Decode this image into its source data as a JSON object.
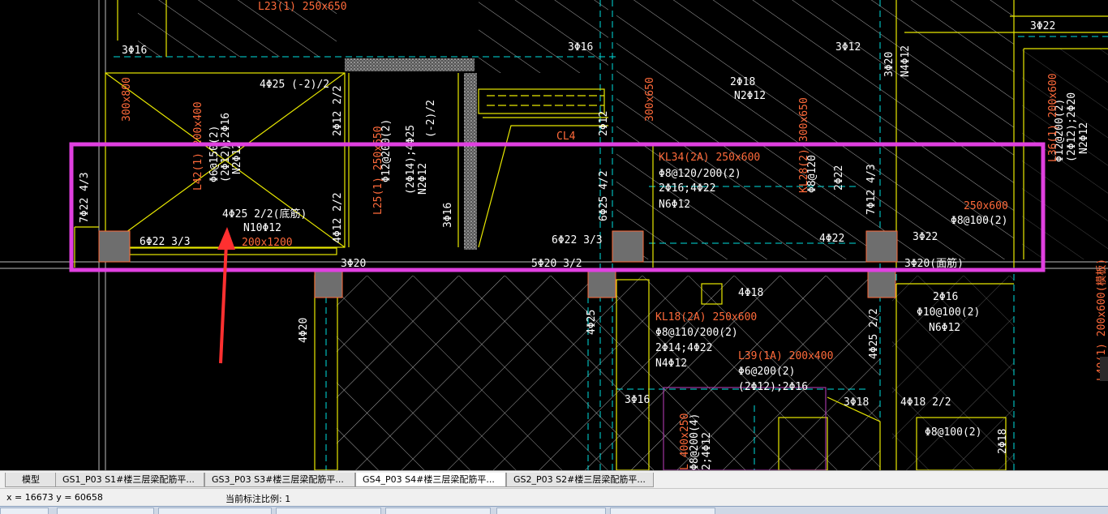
{
  "drawing": {
    "labels": {
      "l23": "L23(1) 250x650",
      "l23_stirrup": "Φ8@200(2)",
      "l23_top": "(2Φ14)",
      "top_left_bar": "3Φ16",
      "mid_top_bar": "3Φ16",
      "right_top_bar": "3Φ12",
      "far_right_bar": "3Φ22",
      "dim_300x800": "300x800",
      "top_4phi25": "4Φ25 (-2)/2",
      "r_2phi12": "2Φ12 2/2",
      "l42_name": "L42(1) 200x400",
      "l42_stirrup": "Φ6@150(2)",
      "l42_bars": "(2Φ12);2Φ16",
      "l42_n": "N2Φ12",
      "l25_name": "L25(1) 250x650",
      "l25_stirrup": "Φ12@200(2)",
      "l25_bars": "(2Φ14);4Φ25",
      "l25_n": "N2Φ12",
      "l25_side": "(-2)/2",
      "mid_3phi16": "3Φ16",
      "cl4": "CL4",
      "mid_6phi25": "6Φ25 4/2",
      "mid_2phi12": "2Φ12",
      "dim_300x650": "300x650",
      "r_2phi18": "2Φ18",
      "r_n2phi12": "N2Φ12",
      "r_300x650": "300x650",
      "r_2phi20": "3Φ20",
      "r_n4phi12": "N4Φ12",
      "kl34_name": "KL34(2A) 250x600",
      "kl34_stirrup": "Φ8@120/200(2)",
      "kl34_bars": "2Φ16;4Φ22",
      "kl34_n": "N6Φ12",
      "kl28_name": "KL28(2)",
      "kl28_stirrup": "Φ8@120",
      "kl28_bar": "2Φ22",
      "kl28_side": "7Φ12 4/3",
      "r_250x600": "250x600",
      "r_phi8": "Φ8@100(2)",
      "l36_name": "L36(1) 200x600",
      "l36_stirrup": "Φ12@200(2)",
      "l36_bars": "(2Φ12);2Φ20",
      "l36_n": "N2Φ12",
      "left_7phi22": "7Φ22 4/3",
      "main_4phi25": "4Φ25 2/2(底筋)",
      "main_n10": "N10Φ12",
      "main_dim": "200x1200",
      "r_2phi12b": "4Φ12 2/2",
      "bottom_6phi22": "6Φ22 3/3",
      "bottom_6phi22b": "6Φ22 3/3",
      "r_4phi22": "4Φ22",
      "r_3phi22": "3Φ22",
      "b_3phi20": "3Φ20",
      "b_5phi20": "5Φ20 3/2",
      "b_4phi20": "4Φ20 3/2",
      "b_3phi20r": "3Φ20(面筋)",
      "v_4phi20": "4Φ20",
      "v_4phi25": "4Φ25",
      "v_4phi25b": "4Φ25 2/2",
      "b_4phi18": "4Φ18",
      "kl18_name": "KL18(2A) 250x600",
      "kl18_stirrup": "Φ8@110/200(2)",
      "kl18_bars": "2Φ14;4Φ22",
      "kl18_n": "N4Φ12",
      "l39_name": "L39(1A) 200x400",
      "l39_stirrup": "Φ6@200(2)",
      "l39_bars": "(2Φ12);2Φ16",
      "rb_2phi16": "2Φ16",
      "rb_stirrup": "Φ10@100(2)",
      "rb_n": "N6Φ12",
      "b_3phi16": "3Φ16",
      "b_3phi18": "3Φ18",
      "b_4phi18_2": "4Φ18 2/2",
      "b_phi8": "Φ8@100(2)",
      "b_2phi18": "2Φ18",
      "b_400x250": "L 400x250",
      "b_200_4": "Φ8@200(4)",
      "b_2_4": "2;4Φ12",
      "right_edge_1": "L40(1) 200x600(模板)",
      "right_edge_2": "(模板)"
    }
  },
  "tabs": [
    {
      "label": "模型",
      "active": false
    },
    {
      "label": "GS1_P03 S1#楼三层梁配筋平...",
      "active": false
    },
    {
      "label": "GS3_P03 S3#楼三层梁配筋平...",
      "active": false
    },
    {
      "label": "GS4_P03 S4#楼三层梁配筋平...",
      "active": true
    },
    {
      "label": "GS2_P03 S2#楼三层梁配筋平...",
      "active": false
    }
  ],
  "status": {
    "coords": "x = 16673  y = 60658",
    "scale": "当前标注比例: 1"
  },
  "colors": {
    "highlight": "#e040e0",
    "arrow": "#ff3030",
    "beam_line": "#e8e800",
    "hatch": "#ffffff",
    "axis": "#00e0e0",
    "label_red": "#ff6a3a",
    "column": "#7f7f7f"
  }
}
